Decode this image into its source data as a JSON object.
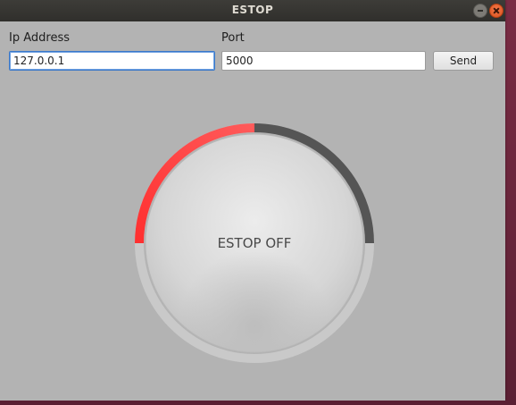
{
  "window": {
    "title": "ESTOP"
  },
  "form": {
    "ip_label": "Ip Address",
    "ip_value": "127.0.0.1",
    "port_label": "Port",
    "port_value": "5000",
    "send_label": "Send"
  },
  "estop": {
    "state_label": "ESTOP OFF",
    "active_color": "#ff4b4b",
    "inactive_color": "#555555"
  }
}
